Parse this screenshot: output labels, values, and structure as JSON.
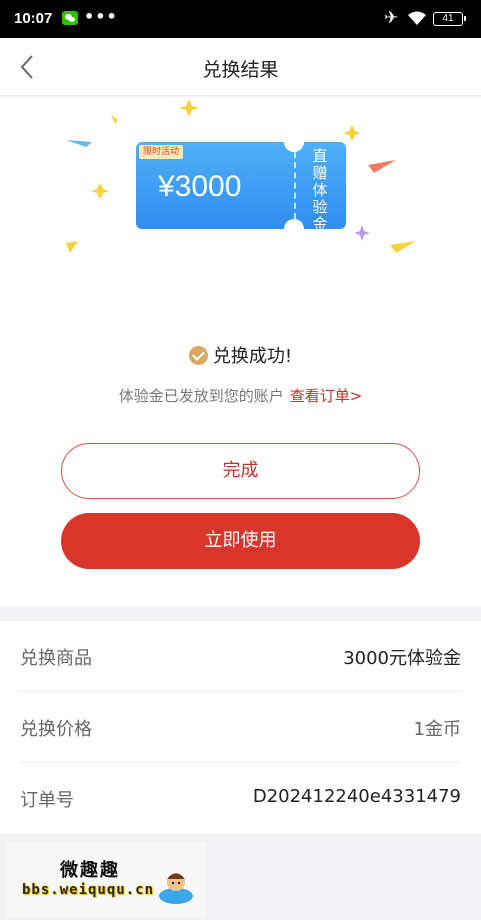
{
  "status_bar": {
    "time": "10:07",
    "more": "•••",
    "battery": "41",
    "icons": [
      "wechat-icon",
      "airplane-icon",
      "wifi-icon",
      "battery-icon"
    ]
  },
  "nav": {
    "title": "兑换结果",
    "back_icon": "chevron-left-icon"
  },
  "coupon": {
    "tag": "限时活动",
    "amount": "¥3000",
    "stub_text": "直赠体验金"
  },
  "result": {
    "status": "兑换成功!",
    "info": "体验金已发放到您的账户",
    "view_order": "查看订单>"
  },
  "actions": {
    "done_label": "完成",
    "use_label": "立即使用"
  },
  "details": [
    {
      "label": "兑换商品",
      "value": "3000元体验金"
    },
    {
      "label": "兑换价格",
      "value": "1金币"
    },
    {
      "label": "订单号",
      "value": "D202412240e4331479"
    }
  ],
  "watermark": {
    "title": "微趣趣",
    "url": "bbs.weiququ.cn"
  },
  "colors": {
    "accent_red": "#d8352b",
    "coupon_blue": "#3a9af3",
    "check_gold": "#d9a861"
  }
}
